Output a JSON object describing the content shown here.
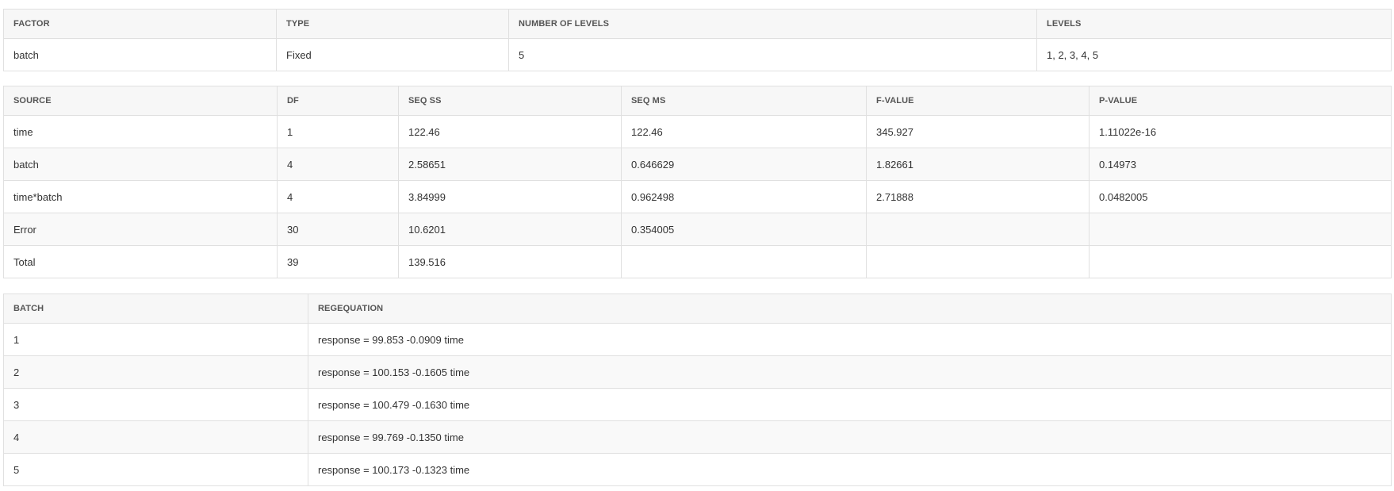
{
  "factor_table": {
    "headers": [
      "FACTOR",
      "TYPE",
      "NUMBER OF LEVELS",
      "LEVELS"
    ],
    "rows": [
      [
        "batch",
        "Fixed",
        "5",
        "1, 2, 3, 4, 5"
      ]
    ]
  },
  "anova_table": {
    "headers": [
      "SOURCE",
      "DF",
      "SEQ SS",
      "SEQ MS",
      "F-VALUE",
      "P-VALUE"
    ],
    "rows": [
      [
        "time",
        "1",
        "122.46",
        "122.46",
        "345.927",
        "1.11022e-16"
      ],
      [
        "batch",
        "4",
        "2.58651",
        "0.646629",
        "1.82661",
        "0.14973"
      ],
      [
        "time*batch",
        "4",
        "3.84999",
        "0.962498",
        "2.71888",
        "0.0482005"
      ],
      [
        "Error",
        "30",
        "10.6201",
        "0.354005",
        "",
        ""
      ],
      [
        "Total",
        "39",
        "139.516",
        "",
        "",
        ""
      ]
    ]
  },
  "regression_table": {
    "headers": [
      "BATCH",
      "REGEQUATION"
    ],
    "rows": [
      [
        "1",
        "response = 99.853 -0.0909 time"
      ],
      [
        "2",
        "response = 100.153 -0.1605 time"
      ],
      [
        "3",
        "response = 100.479 -0.1630 time"
      ],
      [
        "4",
        "response = 99.769 -0.1350 time"
      ],
      [
        "5",
        "response = 100.173 -0.1323 time"
      ]
    ]
  }
}
